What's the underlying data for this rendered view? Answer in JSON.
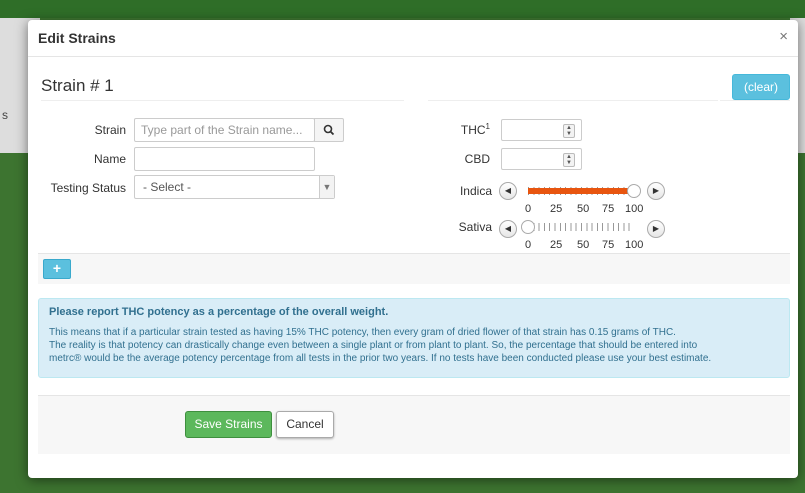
{
  "background": {
    "left_fragment": "s"
  },
  "modal": {
    "title": "Edit Strains",
    "close_glyph": "×"
  },
  "strain": {
    "heading": "Strain # 1",
    "clear_label": "(clear)",
    "fields": {
      "strain_label": "Strain",
      "strain_placeholder": "Type part of the Strain name...",
      "name_label": "Name",
      "name_value": "",
      "testing_status_label": "Testing Status",
      "testing_status_value": "- Select -",
      "thc_label": "THC",
      "thc_footnote": "1",
      "thc_value": "",
      "cbd_label": "CBD",
      "cbd_value": ""
    },
    "sliders": {
      "indica": {
        "label": "Indica",
        "value_percent": 100
      },
      "sativa": {
        "label": "Sativa",
        "value_percent": 0
      },
      "tick_labels": [
        "0",
        "25",
        "50",
        "75",
        "100"
      ]
    }
  },
  "add_button_label": "+",
  "info": {
    "title": "Please report THC potency as a percentage of the overall weight.",
    "line1": "This means that if a particular strain tested as having 15% THC potency, then every gram of dried flower of that strain has 0.15 grams of THC.",
    "line2": "The reality is that potency can drastically change even between a single plant or from plant to plant. So, the percentage that should be entered into",
    "line3": "metrc® would be the average potency percentage from all tests in the prior two years. If no tests have been conducted please use your best estimate."
  },
  "footer": {
    "save_label": "Save Strains",
    "cancel_label": "Cancel"
  },
  "colors": {
    "slider_fill": "#e8550f",
    "info_bg": "#d9edf7",
    "info_text": "#31708f",
    "save_bg": "#5cb85c",
    "clear_bg": "#5bc0de"
  }
}
